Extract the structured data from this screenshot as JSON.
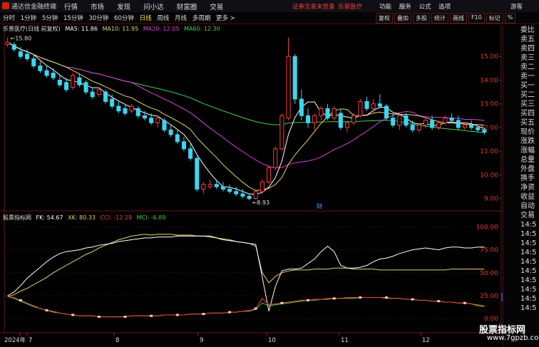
{
  "app": {
    "title": "通达信金融终端"
  },
  "menu": [
    "行情",
    "市场",
    "发现",
    "问小达",
    "财富圈",
    "交易"
  ],
  "top_notice": {
    "login_warning": "证券交易未登录",
    "stock_name": "乐普医疗"
  },
  "top_right": [
    "功能",
    "服务",
    "公式",
    "选项"
  ],
  "guest_label": "游客",
  "periods": [
    "分时",
    "1分钟",
    "5分钟",
    "15分钟",
    "30分钟",
    "60分钟",
    "日线",
    "周线",
    "月线",
    "多周期",
    "更多 >"
  ],
  "active_period": "日线",
  "tools": [
    "复权",
    "叠加",
    "多股",
    "统计",
    "画线",
    "F10",
    "标记",
    "%"
  ],
  "chart_header": "乐普医疗(日线 前复权)",
  "ma_legend": [
    {
      "text": "MA5: 11.86",
      "color": "#ffffff"
    },
    {
      "text": "MA10: 11.95",
      "color": "#e6d66a"
    },
    {
      "text": "MA20: 12.05",
      "color": "#e040e0"
    },
    {
      "text": "MA60: 12.30",
      "color": "#3fd24a"
    }
  ],
  "price_axis": [
    "15.00",
    "14.00",
    "13.00",
    "12.00",
    "11.00",
    "10.00",
    "9.00"
  ],
  "annotations": {
    "high": "15.80",
    "low": "8.93",
    "finance_mark": "财"
  },
  "indicator_legend": [
    {
      "text": "股票指标网",
      "color": "#dddddd"
    },
    {
      "text": "FK: 54.67",
      "color": "#ffffff"
    },
    {
      "text": "XK: 80.33",
      "color": "#e6d66a"
    },
    {
      "text": "CCI: -12.29",
      "color": "#ff4040"
    },
    {
      "text": "MCI: -6.89",
      "color": "#3fd24a"
    }
  ],
  "indicator_axis": [
    "100.00",
    "75.00",
    "50.00",
    "25.00",
    "0.00"
  ],
  "indicator_tag": "23.52",
  "dates": [
    "2024年",
    "7",
    "8",
    "9",
    "10",
    "11",
    "12"
  ],
  "side_panel": [
    "委比",
    "卖五",
    "卖四",
    "卖三",
    "卖二",
    "卖一",
    "买一",
    "买二",
    "买三",
    "买四",
    "买五",
    "现价",
    "涨跌",
    "涨幅",
    "总量",
    "外盘",
    "换手",
    "净资",
    "收益",
    "自动",
    "交易",
    "14:5",
    "14:5",
    "14:5",
    "14:5",
    "14:5",
    "14:5",
    "14:5",
    "14:5",
    "14:5",
    "14:5"
  ],
  "watermark": {
    "title": "股票指标网",
    "url": "www.7gpzb.com"
  },
  "colors": {
    "up": "#ff3b3b",
    "down": "#3ad6f0",
    "ma5": "#ffffff",
    "ma10": "#e6d66a",
    "ma20": "#e040e0",
    "ma60": "#3fd24a"
  },
  "chart_data": {
    "type": "candlestick",
    "ylim": [
      8.6,
      16.0
    ],
    "candles": [
      [
        15.5,
        15.8,
        15.4,
        15.6
      ],
      [
        15.5,
        15.6,
        15.2,
        15.3
      ],
      [
        15.2,
        15.4,
        14.9,
        15.0
      ],
      [
        15.1,
        15.3,
        14.8,
        14.9
      ],
      [
        14.9,
        15.1,
        14.5,
        14.6
      ],
      [
        14.6,
        14.8,
        14.3,
        14.4
      ],
      [
        14.4,
        14.6,
        14.1,
        14.2
      ],
      [
        14.3,
        14.5,
        14.0,
        14.1
      ],
      [
        14.0,
        14.2,
        13.7,
        13.8
      ],
      [
        13.9,
        14.1,
        13.5,
        13.6
      ],
      [
        13.7,
        14.3,
        13.6,
        14.2
      ],
      [
        14.1,
        14.3,
        13.7,
        13.8
      ],
      [
        13.9,
        14.0,
        13.4,
        13.5
      ],
      [
        13.5,
        13.7,
        13.2,
        13.3
      ],
      [
        13.4,
        13.7,
        13.3,
        13.6
      ],
      [
        13.5,
        13.6,
        13.0,
        13.1
      ],
      [
        13.2,
        13.4,
        12.8,
        12.9
      ],
      [
        12.9,
        13.1,
        12.6,
        12.7
      ],
      [
        12.8,
        13.0,
        12.5,
        12.6
      ],
      [
        12.7,
        13.0,
        12.6,
        12.9
      ],
      [
        12.8,
        12.9,
        12.4,
        12.5
      ],
      [
        12.5,
        12.7,
        12.3,
        12.4
      ],
      [
        12.4,
        12.6,
        12.1,
        12.2
      ],
      [
        12.2,
        12.5,
        12.0,
        12.4
      ],
      [
        12.3,
        12.4,
        11.8,
        11.9
      ],
      [
        11.9,
        12.1,
        11.6,
        11.7
      ],
      [
        11.7,
        11.9,
        11.3,
        11.4
      ],
      [
        11.4,
        11.6,
        11.0,
        11.1
      ],
      [
        11.1,
        11.3,
        10.6,
        10.7
      ],
      [
        10.7,
        10.8,
        9.3,
        9.4
      ],
      [
        9.4,
        9.7,
        9.2,
        9.6
      ],
      [
        9.5,
        9.8,
        9.4,
        9.6
      ],
      [
        9.6,
        9.8,
        9.4,
        9.5
      ],
      [
        9.5,
        9.7,
        9.3,
        9.4
      ],
      [
        9.4,
        9.6,
        9.2,
        9.3
      ],
      [
        9.3,
        9.5,
        9.1,
        9.2
      ],
      [
        9.2,
        9.4,
        9.0,
        9.1
      ],
      [
        9.1,
        9.2,
        8.93,
        9.0
      ],
      [
        9.0,
        9.4,
        8.95,
        9.3
      ],
      [
        9.3,
        9.8,
        9.2,
        9.7
      ],
      [
        9.7,
        10.4,
        9.6,
        10.3
      ],
      [
        10.3,
        11.2,
        10.2,
        11.1
      ],
      [
        11.1,
        12.6,
        11.0,
        12.5
      ],
      [
        12.4,
        15.8,
        12.3,
        15.0
      ],
      [
        15.0,
        15.1,
        13.0,
        13.2
      ],
      [
        13.2,
        13.6,
        12.3,
        12.5
      ],
      [
        12.5,
        12.8,
        12.0,
        12.2
      ],
      [
        12.2,
        12.6,
        11.9,
        12.5
      ],
      [
        12.5,
        12.9,
        12.3,
        12.8
      ],
      [
        12.8,
        13.0,
        12.3,
        12.4
      ],
      [
        12.4,
        12.9,
        12.3,
        12.8
      ],
      [
        12.6,
        12.8,
        11.9,
        12.0
      ],
      [
        12.0,
        12.3,
        11.8,
        12.2
      ],
      [
        12.2,
        12.6,
        12.1,
        12.5
      ],
      [
        12.5,
        13.2,
        12.4,
        13.1
      ],
      [
        13.1,
        13.3,
        12.7,
        12.8
      ],
      [
        12.8,
        13.2,
        12.6,
        13.0
      ],
      [
        13.0,
        13.4,
        12.8,
        12.9
      ],
      [
        12.9,
        13.0,
        12.3,
        12.4
      ],
      [
        12.4,
        12.6,
        12.0,
        12.1
      ],
      [
        12.1,
        12.6,
        11.9,
        12.5
      ],
      [
        12.5,
        12.6,
        12.0,
        12.1
      ],
      [
        12.1,
        12.3,
        11.8,
        11.9
      ],
      [
        11.9,
        12.2,
        11.8,
        12.1
      ],
      [
        12.1,
        12.4,
        12.0,
        12.3
      ],
      [
        12.3,
        12.5,
        11.9,
        12.0
      ],
      [
        12.0,
        12.3,
        11.9,
        12.2
      ],
      [
        12.2,
        12.5,
        12.1,
        12.4
      ],
      [
        12.4,
        12.6,
        12.2,
        12.3
      ],
      [
        12.3,
        12.5,
        11.9,
        12.0
      ],
      [
        12.0,
        12.2,
        11.9,
        12.1
      ],
      [
        12.1,
        12.3,
        11.9,
        12.0
      ],
      [
        12.0,
        12.1,
        11.8,
        11.9
      ],
      [
        11.9,
        12.0,
        11.7,
        11.8
      ]
    ],
    "indicator_ylim": [
      -10,
      105
    ],
    "fk": [
      25,
      29,
      36,
      44,
      50,
      56,
      62,
      67,
      71,
      73,
      74,
      75,
      77,
      78,
      80,
      81,
      82,
      84,
      85,
      86,
      87,
      88,
      88,
      89,
      89,
      89,
      90,
      90,
      90,
      90,
      90,
      90,
      88,
      86,
      85,
      84,
      83,
      82,
      81,
      45,
      8,
      35,
      52,
      54,
      54,
      55,
      60,
      65,
      73,
      79,
      73,
      58,
      55,
      55,
      56,
      58,
      62,
      65,
      66,
      68,
      71,
      73,
      75,
      76,
      77,
      76,
      75,
      77,
      78,
      78,
      77,
      77,
      78,
      78
    ],
    "xk": [
      24,
      26,
      30,
      33,
      37,
      41,
      45,
      50,
      54,
      58,
      62,
      66,
      70,
      73,
      77,
      80,
      83,
      86,
      88,
      90,
      91,
      92,
      91,
      92,
      92,
      92,
      91,
      91,
      91,
      90,
      90,
      89,
      88,
      87,
      86,
      84,
      83,
      82,
      79,
      50,
      39,
      46,
      50,
      52,
      53,
      53,
      53,
      54,
      54,
      54,
      55,
      55,
      55,
      54,
      54,
      54,
      54,
      53,
      53,
      53,
      53,
      53,
      53,
      53,
      53,
      53,
      53,
      53,
      54,
      54,
      54,
      54,
      54,
      54
    ],
    "cci": [
      24,
      23,
      20,
      17,
      14,
      11,
      9,
      8,
      6,
      5,
      4,
      3,
      3,
      3,
      2,
      2,
      2,
      2,
      2,
      3,
      3,
      3,
      3,
      3,
      4,
      4,
      4,
      4,
      5,
      5,
      5,
      6,
      6,
      6,
      7,
      7,
      8,
      9,
      11,
      22,
      15,
      16,
      17,
      18,
      19,
      20,
      20,
      21,
      21,
      22,
      22,
      22,
      23,
      23,
      23,
      23,
      23,
      23,
      23,
      22,
      22,
      21,
      21,
      20,
      20,
      19,
      19,
      18,
      18,
      17,
      17,
      16,
      15,
      14
    ],
    "mci": [
      24,
      22,
      19,
      16,
      13,
      11,
      9,
      7,
      6,
      5,
      4,
      3,
      3,
      3,
      2,
      2,
      2,
      2,
      2,
      3,
      3,
      3,
      3,
      3,
      4,
      4,
      4,
      4,
      5,
      5,
      5,
      6,
      6,
      6,
      7,
      7,
      8,
      8,
      10,
      17,
      14,
      15,
      16,
      17,
      18,
      19,
      20,
      20,
      21,
      21,
      22,
      22,
      22,
      22,
      23,
      23,
      23,
      23,
      22,
      22,
      22,
      21,
      21,
      20,
      20,
      19,
      19,
      18,
      18,
      17,
      17,
      16,
      14,
      13
    ]
  }
}
